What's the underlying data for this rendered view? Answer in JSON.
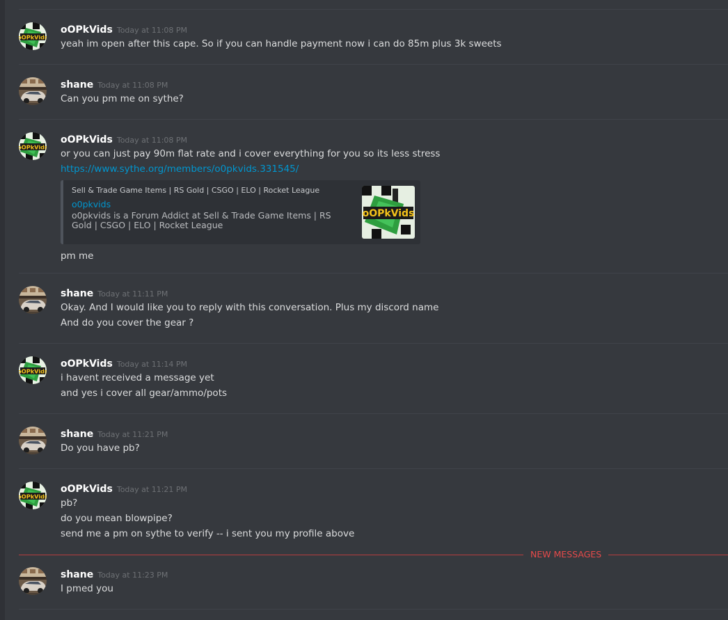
{
  "colors": {
    "background": "#36393e",
    "username": "#ffffff",
    "timestamp": "#6e7175",
    "link": "#0096cf",
    "new_messages": "#e74a4a"
  },
  "icons": {
    "opk_avatar": "avatar-opk-logo",
    "shane_avatar": "avatar-shane-car"
  },
  "messages": [
    {
      "author": "oOPkVids",
      "timestamp": "Today at 11:08 PM",
      "lines": [
        "yeah im open after this cape. So if you can handle payment now i can do 85m plus 3k sweets"
      ]
    },
    {
      "author": "shane",
      "timestamp": "Today at 11:08 PM",
      "lines": [
        "Can you pm me on sythe?"
      ]
    },
    {
      "author": "oOPkVids",
      "timestamp": "Today at 11:08 PM",
      "lines": [
        "or you can just pay 90m flat rate and i cover everything for you so its less stress"
      ],
      "link": "https://www.sythe.org/members/o0pkvids.331545/",
      "embed": {
        "provider": "Sell & Trade Game Items | RS Gold | CSGO | ELO | Rocket League",
        "title": "o0pkvids",
        "description": "o0pkvids is a Forum Addict at Sell & Trade Game Items | RS Gold | CSGO | ELO | Rocket League",
        "thumbnail_text": "oOPkVids"
      },
      "after": "pm me"
    },
    {
      "author": "shane",
      "timestamp": "Today at 11:11 PM",
      "lines": [
        "Okay. And I would like you to reply with this conversation. Plus my discord name",
        "And do you cover the gear ?"
      ]
    },
    {
      "author": "oOPkVids",
      "timestamp": "Today at 11:14 PM",
      "lines": [
        "i havent received a message yet",
        "and yes i cover all gear/ammo/pots"
      ]
    },
    {
      "author": "shane",
      "timestamp": "Today at 11:21 PM",
      "lines": [
        "Do you have pb?"
      ]
    },
    {
      "author": "oOPkVids",
      "timestamp": "Today at 11:21 PM",
      "lines": [
        "pb?",
        "do you mean blowpipe?",
        "send me a pm on sythe to verify -- i sent you my profile above"
      ]
    },
    {
      "author": "shane",
      "timestamp": "Today at 11:23 PM",
      "lines": [
        "I pmed you"
      ]
    }
  ],
  "new_messages_label": "NEW MESSAGES"
}
